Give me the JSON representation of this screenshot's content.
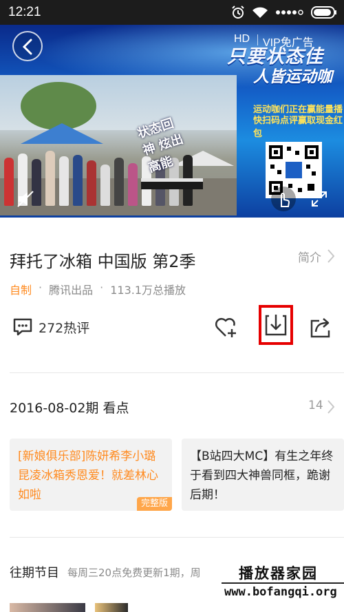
{
  "status_bar": {
    "time": "12:21",
    "icons": [
      "alarm-icon",
      "wifi-icon",
      "signal-dots-icon",
      "battery-icon"
    ]
  },
  "player": {
    "quality": "HD",
    "vip_ad_label": "VIP免广告",
    "slogan_line1": "只要状态佳",
    "slogan_line2": "人皆运动咖",
    "side_text_line1": "运动咖们正在赢能量播",
    "side_text_line2": "快扫码点评赢取现金红包",
    "frame_caption": "状态回神 炫出高能",
    "icons": [
      "back-icon",
      "mute-icon",
      "touch-icon",
      "fullscreen-icon",
      "qr-code"
    ]
  },
  "show": {
    "title": "拜托了冰箱 中国版 第2季",
    "intro_label": "简介",
    "self_made": "自制",
    "producer": "腾讯出品",
    "play_count": "113.1万总播放"
  },
  "actions": {
    "comments": "272热评",
    "icons": [
      "comment-icon",
      "favorite-add-icon",
      "download-icon",
      "share-icon"
    ]
  },
  "highlights": {
    "heading": "2016-08-02期 看点",
    "count": "14",
    "cards": [
      {
        "text": "[新娘俱乐部]陈妍希李小璐昆凌冰箱秀恩爱！就差林心如啦",
        "tag": "完整版"
      },
      {
        "text": "【B站四大MC】有生之年终于看到四大神兽同框，跪谢后期！",
        "tag": ""
      }
    ]
  },
  "past_episodes": {
    "heading": "往期节目",
    "schedule": "每周三20点免费更新1期，周"
  },
  "watermark": {
    "title": "播放器家园",
    "url": "www.bofangqi.org"
  },
  "colors": {
    "accent_orange": "#ff8a1f",
    "highlight_red": "#e60000",
    "status_bar_bg": "#1c1c1c"
  }
}
